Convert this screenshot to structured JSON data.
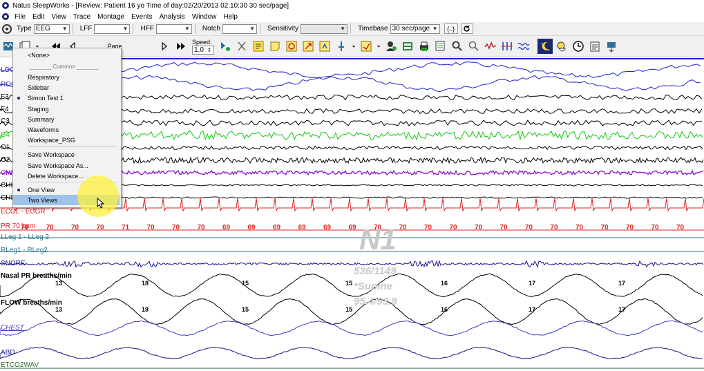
{
  "title": "Natus SleepWorks - [Review:  Patient 16 yo   Time of day:02/20/2013 02:10:30   30 sec/page]",
  "menu": [
    "File",
    "Edit",
    "View",
    "Trace",
    "Montage",
    "Events",
    "Analysis",
    "Window",
    "Help"
  ],
  "toolbar1": {
    "type_label": "Type",
    "type_value": "EEG",
    "lff_label": "LFF",
    "lff_value": "",
    "hff_label": "HFF",
    "hff_value": "",
    "notch_label": "Notch",
    "notch_value": "",
    "sensitivity_label": "Sensitivity",
    "sensitivity_value": "",
    "timebase_label": "Timebase",
    "timebase_value": "30 sec/page",
    "bracket_button": "{..}"
  },
  "toolbar2": {
    "page_label": "Page",
    "speed_label": "Speed:",
    "speed_value": "1.0"
  },
  "dropdown": {
    "items": [
      {
        "label": "<None>",
        "checked": false,
        "highlighted": false
      },
      {
        "label": "_______ Common _______",
        "checked": false,
        "highlighted": false,
        "muted": true
      },
      {
        "label": "Respiratory",
        "checked": false,
        "highlighted": false
      },
      {
        "label": "Sidebar",
        "checked": false,
        "highlighted": false
      },
      {
        "label": "Simon Test 1",
        "checked": true,
        "highlighted": false
      },
      {
        "label": "Staging",
        "checked": false,
        "highlighted": false
      },
      {
        "label": "Summary",
        "checked": false,
        "highlighted": false
      },
      {
        "label": "Waveforms",
        "checked": false,
        "highlighted": false
      },
      {
        "label": "Workspace_PSG",
        "checked": false,
        "highlighted": false
      },
      {
        "label": "Save Workspace",
        "checked": false,
        "highlighted": false
      },
      {
        "label": "Save Workspace As...",
        "checked": false,
        "highlighted": false
      },
      {
        "label": "Delete Workspace...",
        "checked": false,
        "highlighted": false
      },
      {
        "label": "One View",
        "checked": true,
        "highlighted": false
      },
      {
        "label": "Two Views",
        "checked": false,
        "highlighted": true
      }
    ]
  },
  "channels": [
    {
      "label": "LOC",
      "color": "#1f1fcf"
    },
    {
      "label": "ROC",
      "color": "#1f1fcf"
    },
    {
      "label": "F3",
      "color": "#000000"
    },
    {
      "label": "F4",
      "color": "#000000"
    },
    {
      "label": "C3",
      "color": "#000000"
    },
    {
      "label": "C4",
      "color": "#11c711"
    },
    {
      "label": "O1",
      "color": "#000000"
    },
    {
      "label": "O2",
      "color": "#000000"
    },
    {
      "label": "CHI",
      "color": "#8a1fc9"
    },
    {
      "label": "CHI",
      "color": "#000000"
    },
    {
      "label": "CHI",
      "color": "#000000"
    },
    {
      "label": "ECGL - ECGR",
      "color": "#e02020"
    },
    {
      "label": "PR  70  bpm",
      "color": "#e02020"
    },
    {
      "label": "LLeg 1 - LLeg 2",
      "color": "#2b6e8a"
    },
    {
      "label": "RLeg1 - RLeg2",
      "color": "#2b6e8a"
    },
    {
      "label": "SNORE",
      "color": "#10108f"
    },
    {
      "label": "Nasal PR  breaths/min",
      "color": "#000000"
    },
    {
      "label": "FLOW  breaths/min",
      "color": "#000000"
    },
    {
      "label": "CHEST",
      "color": "#3a3ac8"
    },
    {
      "label": "ABD",
      "color": "#10108f"
    },
    {
      "label": "ETCO2WAV",
      "color": "#2a6e30"
    }
  ],
  "pr_values": [
    "70",
    "70",
    "70",
    "70",
    "71",
    "70",
    "70",
    "70",
    "69",
    "69",
    "69",
    "69",
    "69",
    "69",
    "70",
    "70",
    "70",
    "70",
    "70",
    "70",
    "70",
    "70",
    "70",
    "70",
    "70",
    "70",
    "70"
  ],
  "nasal_values": [
    "13",
    "18",
    "15",
    "15",
    "16",
    "17",
    "17"
  ],
  "flow_values": [
    "13",
    "18",
    "15",
    "15",
    "16",
    "17",
    "17"
  ],
  "stage": {
    "label": "N1",
    "epoch": "536/1149",
    "position": "*Supine",
    "spo2": "95.4/93.8"
  }
}
